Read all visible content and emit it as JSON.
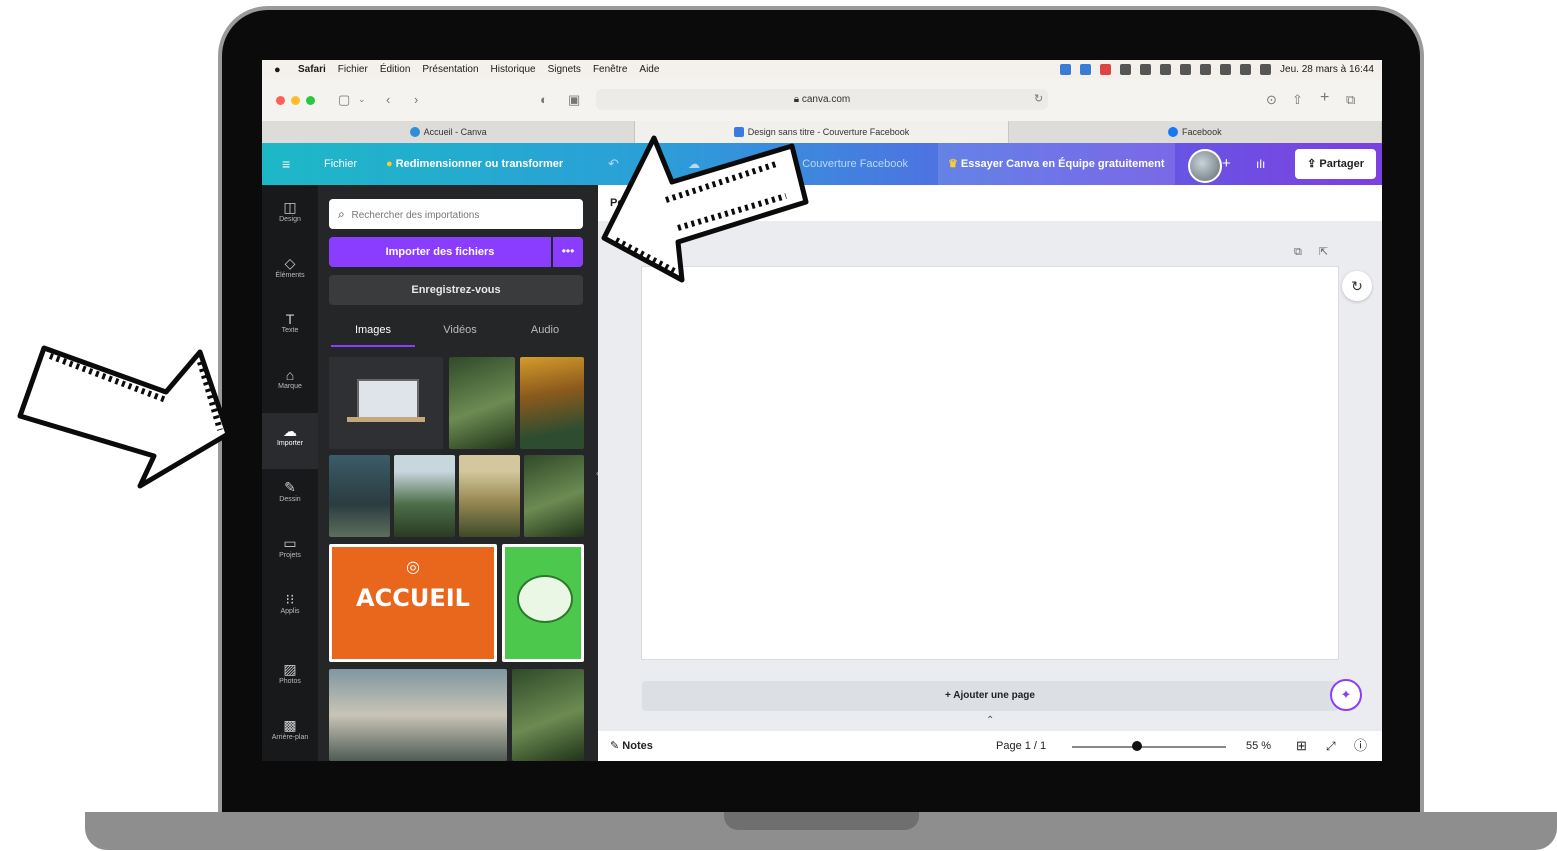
{
  "menubar": {
    "apple": "",
    "items": [
      "Safari",
      "Fichier",
      "Édition",
      "Présentation",
      "Historique",
      "Signets",
      "Fenêtre",
      "Aide"
    ],
    "clock": "Jeu. 28 mars à 16:44"
  },
  "safari": {
    "url": "canva.com",
    "tabs": [
      "Accueil - Canva",
      "Design sans titre - Couverture Facebook",
      "Facebook"
    ]
  },
  "canva_header": {
    "file": "Fichier",
    "resize": "Redimensionner ou transformer",
    "title": "Sans titre - Couverture Facebook",
    "trial": "Essayer Canva en Équipe gratuitement",
    "share": "Partager"
  },
  "sidebar": {
    "items": [
      "Design",
      "Éléments",
      "Texte",
      "Marque",
      "Importer",
      "Dessin",
      "Projets",
      "Applis",
      "Photos",
      "Arrière-plan"
    ]
  },
  "panel": {
    "search_placeholder": "Rechercher des importations",
    "import": "Importer des fichiers",
    "more": "•••",
    "signup": "Enregistrez-vous",
    "tabs": [
      "Images",
      "Vidéos",
      "Audio"
    ],
    "accueil": "ACCUEIL"
  },
  "editor": {
    "position": "Position",
    "add_page": "+ Ajouter une page",
    "notes": "Notes",
    "page": "Page 1 / 1",
    "zoom": "55 %",
    "zoom_fraction": 0.42
  }
}
